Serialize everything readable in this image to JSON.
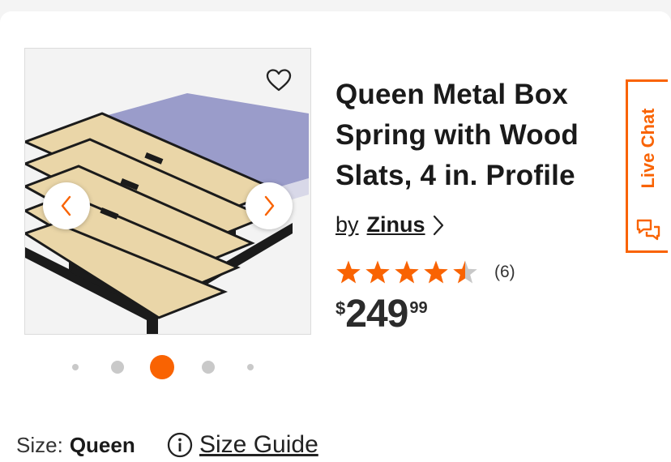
{
  "product": {
    "title": "Queen Metal Box Spring with Wood Slats, 4 in. Profile",
    "by_label": "by",
    "brand": "Zinus",
    "rating": 4.5,
    "review_count": "(6)",
    "price": {
      "currency": "$",
      "dollars": "249",
      "cents": "99"
    }
  },
  "gallery": {
    "image_count": 5,
    "active_index": 2,
    "favorite_icon": "heart-outline-icon",
    "prev_icon": "chevron-left-icon",
    "next_icon": "chevron-right-icon"
  },
  "live_chat": {
    "label": "Live Chat",
    "icon": "chat-bubbles-icon"
  },
  "size": {
    "label": "Size:",
    "value": "Queen"
  },
  "size_guide": {
    "label": "Size Guide",
    "icon": "info-circle-icon"
  },
  "colors": {
    "accent": "#f96302",
    "star": "#f96302",
    "star_empty": "#c8c8c8"
  }
}
